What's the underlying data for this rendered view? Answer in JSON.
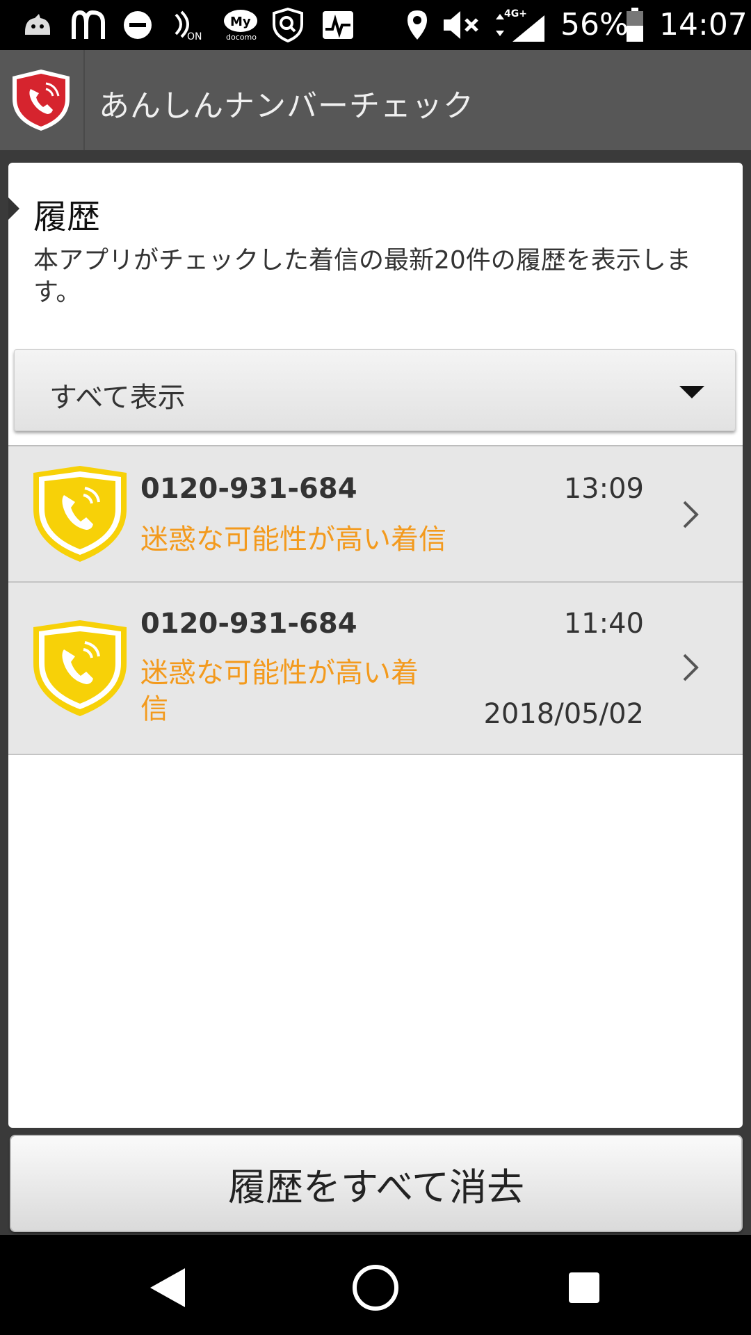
{
  "status_bar": {
    "icons": [
      "dragon-icon",
      "mcdonalds-icon",
      "do-not-disturb-icon",
      "nfc-on-icon",
      "my-docomo-icon",
      "shield-search-icon",
      "activity-icon",
      "location-icon",
      "mute-icon",
      "signal-4g-icon",
      "battery-icon"
    ],
    "network": "4G+",
    "battery": "56%",
    "time": "14:07"
  },
  "app_bar": {
    "title": "あんしんナンバーチェック",
    "logo_icon": "phone-shield-icon",
    "logo_color": "#d6242e"
  },
  "history": {
    "title": "履歴",
    "description": "本アプリがチェックした着信の最新20件の履歴を表示します。",
    "filter": {
      "selected": "すべて表示"
    },
    "items": [
      {
        "number": "0120-931-684",
        "time": "13:09",
        "status": "迷惑な可能性が高い着信",
        "date": ""
      },
      {
        "number": "0120-931-684",
        "time": "11:40",
        "status_line1": "迷惑な可能性が高い着",
        "status_line2": "信",
        "date": "2018/05/02"
      }
    ],
    "accent_color": "#f39a1d",
    "shield_color": "#f7d108"
  },
  "footer": {
    "clear_button": "履歴をすべて消去"
  },
  "nav": {
    "back_icon": "back-icon",
    "home_icon": "home-icon",
    "recents_icon": "recents-icon"
  }
}
